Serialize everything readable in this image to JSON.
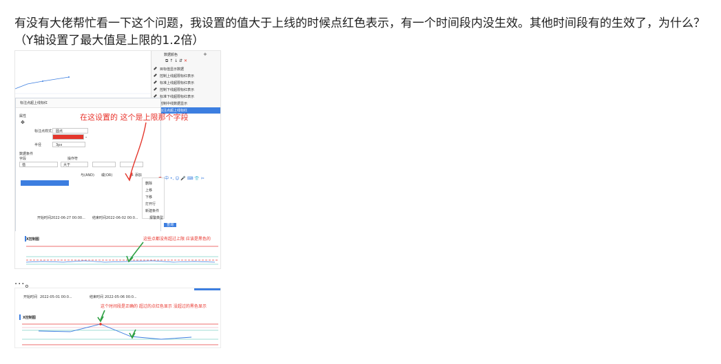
{
  "post": {
    "text": "有没有大佬帮忙看一下这个问题，我设置的值大于上线的时候点红色表示，有一个时间段内没生效。其他时间段有的生效了，为什么？（Y轴设置了最大值是上限的1.2倍）",
    "ellipsis": "···。"
  },
  "shot1": {
    "side_panel": {
      "header": "数据颜色",
      "items": [
        "目标值显示数据",
        "控制上线超限标红表示",
        "标准上线超限标红表示",
        "控制下线超限标红表示",
        "标准下线超限标红表示",
        "控制中线数据显示",
        "标注点超上线标红"
      ],
      "selected_index": 6
    },
    "dialog": {
      "title": "标注点超上线标红",
      "section_attr": "属性",
      "section_cond": "数据条件",
      "labels": {
        "shape": "标注点样式",
        "size": "半径",
        "size_value": "3px",
        "operator_label": "操作符",
        "field_label": "字段",
        "operator_value": "大于",
        "logic_and": "与(AND)",
        "logic_or": "或(OR)",
        "add": "+ 添加",
        "shape_value": "圆点"
      },
      "note": "在这设置的 这个是上限那个字段"
    },
    "float_menu": [
      "删除",
      "上移",
      "下移",
      "打开行",
      "新建条件"
    ],
    "filters": [
      "开始时间",
      "2022-06-27 00:00...",
      "结束时间",
      "2022-06-02 00:0...",
      "报警类型",
      "查询"
    ],
    "chart_title": "X控制图",
    "chart_note": "这些点都没有超过上限 应该是黑色的"
  },
  "shot2": {
    "filters": [
      "开始时间",
      "2022-05-01 00:0...",
      "结束时间",
      "2022-05-06 00:0..."
    ],
    "chart_title": "X控制图",
    "chart_note": "这个时间段是正确的 超过的点红色显示 没超过的黑色显示"
  },
  "colors": {
    "accent": "#3c7ee0",
    "alarm": "#e4362c",
    "ucl": "#e83b3b",
    "lcl": "#7fd1c8"
  }
}
